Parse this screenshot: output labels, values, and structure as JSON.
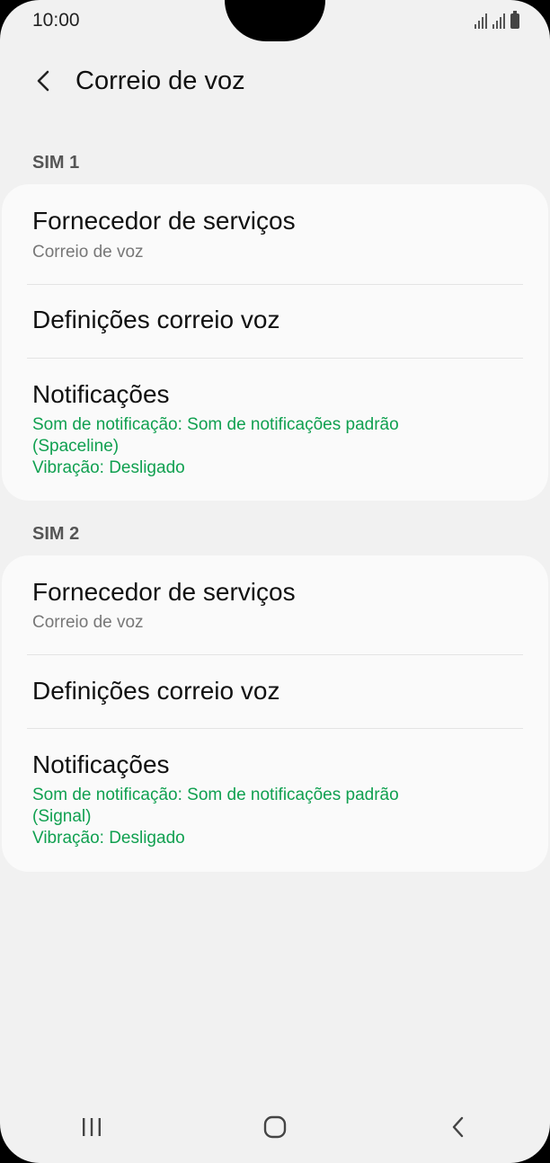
{
  "status_bar": {
    "time": "10:00"
  },
  "header": {
    "title": "Correio de voz"
  },
  "sections": [
    {
      "label": "SIM 1",
      "provider_title": "Fornecedor de serviços",
      "provider_value": "Correio de voz",
      "settings_title": "Definições correio voz",
      "notifications_title": "Notificações",
      "notifications_line1": "Som de notificação: Som de notificações padrão",
      "notifications_line2": "(Spaceline)",
      "notifications_line3": "Vibração: Desligado"
    },
    {
      "label": "SIM 2",
      "provider_title": "Fornecedor de serviços",
      "provider_value": "Correio de voz",
      "settings_title": "Definições correio voz",
      "notifications_title": "Notificações",
      "notifications_line1": "Som de notificação: Som de notificações padrão",
      "notifications_line2": "(Signal)",
      "notifications_line3": "Vibração: Desligado"
    }
  ],
  "icons": {
    "back": "back-arrow-icon",
    "recent_apps": "recent-apps-icon",
    "home": "home-icon",
    "nav_back": "nav-back-icon"
  },
  "colors": {
    "accent_green": "#10a050",
    "background": "#f1f1f1",
    "card": "#fafafa"
  }
}
